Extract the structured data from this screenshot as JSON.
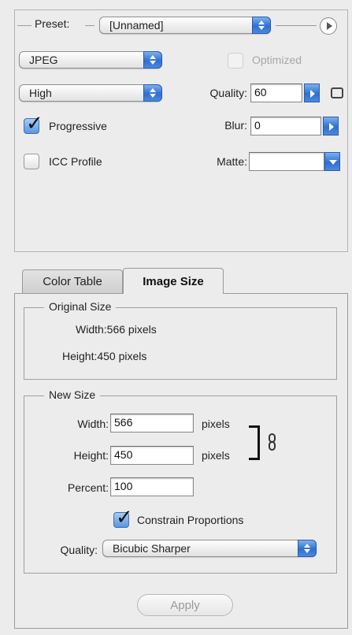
{
  "settings": {
    "preset_label": "Preset:",
    "preset_value": "[Unnamed]",
    "format_value": "JPEG",
    "optimized_label": "Optimized",
    "optimized_checked": false,
    "quality_level_value": "High",
    "quality_label": "Quality:",
    "quality_value": "60",
    "progressive_label": "Progressive",
    "progressive_checked": true,
    "blur_label": "Blur:",
    "blur_value": "0",
    "icc_label": "ICC Profile",
    "icc_checked": false,
    "matte_label": "Matte:",
    "matte_value": ""
  },
  "tabs": [
    {
      "label": "Color Table",
      "active": false
    },
    {
      "label": "Image Size",
      "active": true
    }
  ],
  "original_size": {
    "title": "Original Size",
    "width_text": "Width:566 pixels",
    "height_text": "Height:450 pixels"
  },
  "new_size": {
    "title": "New Size",
    "width_label": "Width:",
    "width_value": "566",
    "width_unit": "pixels",
    "height_label": "Height:",
    "height_value": "450",
    "height_unit": "pixels",
    "percent_label": "Percent:",
    "percent_value": "100",
    "constrain_label": "Constrain Proportions",
    "constrain_checked": true,
    "quality_label": "Quality:",
    "quality_value": "Bicubic Sharper"
  },
  "apply_label": "Apply",
  "icons": [
    "arrow-menu-icon",
    "link-chain-icon",
    "checkmark-icon"
  ],
  "colors": {
    "accent_blue": "#3a7ad6",
    "panel_bg": "#ececec"
  }
}
